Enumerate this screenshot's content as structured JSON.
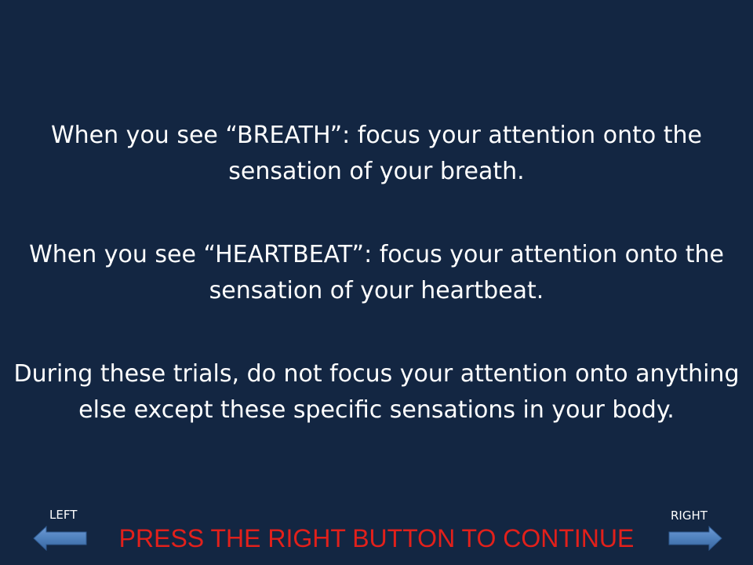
{
  "instructions": {
    "breath": "When you see “BREATH”: focus your attention onto the sensation of your breath.",
    "heartbeat": "When you see “HEARTBEAT”: focus your attention onto the sensation of your heartbeat.",
    "trials": "During these trials, do not focus your attention onto anything else except these specific sensations in your body."
  },
  "navigation": {
    "left_label": "LEFT",
    "right_label": "RIGHT",
    "left_icon": "arrow-left-icon",
    "right_icon": "arrow-right-icon",
    "arrow_color": "#4f81bd"
  },
  "prompt": "PRESS THE RIGHT BUTTON TO CONTINUE",
  "colors": {
    "background": "#132642",
    "text": "#ffffff",
    "prompt": "#e2201b"
  }
}
